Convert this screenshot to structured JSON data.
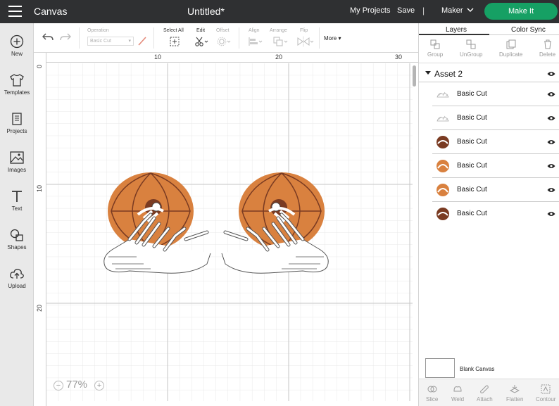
{
  "header": {
    "app_title": "Canvas",
    "doc_title": "Untitled*",
    "my_projects": "My Projects",
    "save": "Save",
    "separator": "|",
    "machine": "Maker",
    "make_it": "Make It",
    "make_it_color": "#16a064"
  },
  "left_nav": {
    "items": [
      {
        "label": "New",
        "icon": "plus-circle-icon"
      },
      {
        "label": "Templates",
        "icon": "tshirt-icon"
      },
      {
        "label": "Projects",
        "icon": "projects-icon"
      },
      {
        "label": "Images",
        "icon": "image-icon"
      },
      {
        "label": "Text",
        "icon": "text-t-icon"
      },
      {
        "label": "Shapes",
        "icon": "shapes-icon"
      },
      {
        "label": "Upload",
        "icon": "upload-cloud-icon"
      }
    ]
  },
  "toolbar": {
    "operation_label": "Operation",
    "operation_value": "Basic Cut",
    "select_all": "Select All",
    "edit": "Edit",
    "offset": "Offset",
    "align": "Align",
    "arrange": "Arrange",
    "flip": "Flip",
    "more": "More"
  },
  "canvas": {
    "ruler_top": [
      "10",
      "20",
      "30"
    ],
    "ruler_left": [
      "0",
      "10",
      "20"
    ],
    "zoom_value": "77%",
    "zoom_minus": "−",
    "zoom_plus": "+",
    "pumpkin_color": "#d9813f",
    "pumpkin_dark": "#7a3b22"
  },
  "right_panel": {
    "tab_layers": "Layers",
    "tab_color_sync": "Color Sync",
    "actions": [
      "Group",
      "UnGroup",
      "Duplicate",
      "Delete"
    ],
    "group_name": "Asset 2",
    "layers": [
      {
        "name": "Basic Cut",
        "thumb": "white-hands"
      },
      {
        "name": "Basic Cut",
        "thumb": "white-hands"
      },
      {
        "name": "Basic Cut",
        "thumb": "dark-pumpkin"
      },
      {
        "name": "Basic Cut",
        "thumb": "orange-pumpkin"
      },
      {
        "name": "Basic Cut",
        "thumb": "orange-pumpkin"
      },
      {
        "name": "Basic Cut",
        "thumb": "dark-pumpkin"
      }
    ],
    "blank_canvas": "Blank Canvas",
    "bottom_actions": [
      "Slice",
      "Weld",
      "Attach",
      "Flatten",
      "Contour"
    ]
  }
}
